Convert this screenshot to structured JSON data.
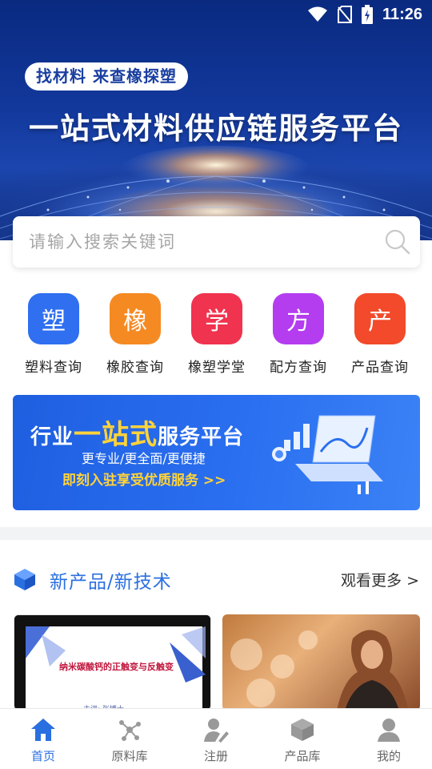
{
  "status_bar": {
    "time": "11:26"
  },
  "hero": {
    "slogan": "找材料 来查橡探塑",
    "title": "一站式材料供应链服务平台"
  },
  "search": {
    "placeholder": "请输入搜索关键词"
  },
  "categories": [
    {
      "char": "塑",
      "label": "塑料查询",
      "color": "#2f6ff0"
    },
    {
      "char": "橡",
      "label": "橡胶查询",
      "color": "#f58a23"
    },
    {
      "char": "学",
      "label": "橡塑学堂",
      "color": "#f0334f"
    },
    {
      "char": "方",
      "label": "配方查询",
      "color": "#b43df0"
    },
    {
      "char": "产",
      "label": "产品查询",
      "color": "#f24a2a"
    }
  ],
  "promo": {
    "title_prefix": "行业",
    "title_highlight": "一站式",
    "title_suffix": "服务平台",
    "subtitle": "更专业/更全面/更便捷",
    "cta": "即刻入驻享受优质服务 >>"
  },
  "section": {
    "title": "新产品/新技术",
    "more": "观看更多 >"
  },
  "cards": [
    {
      "caption": "纳米碳酸钙的正触变与反触变",
      "caption2": "主讲: 张博士"
    }
  ],
  "bottom_nav": [
    {
      "label": "首页",
      "active": true
    },
    {
      "label": "原料库",
      "active": false
    },
    {
      "label": "注册",
      "active": false
    },
    {
      "label": "产品库",
      "active": false
    },
    {
      "label": "我的",
      "active": false
    }
  ],
  "colors": {
    "accent": "#2a6fe0",
    "highlight": "#ffd33a"
  }
}
